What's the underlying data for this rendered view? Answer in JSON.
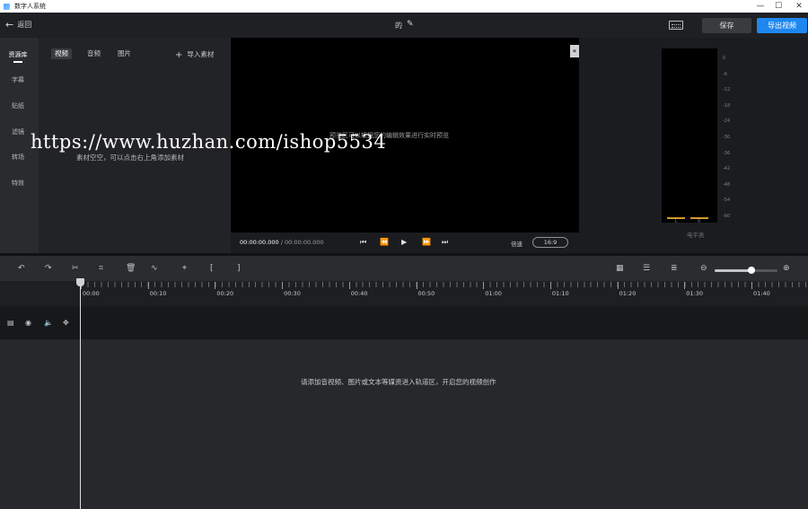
{
  "window": {
    "title": "数字人系统",
    "controls": [
      "—",
      "☐",
      "✕"
    ]
  },
  "topbar": {
    "back_label": "返回",
    "project_name": "的",
    "save_label": "保存",
    "export_label": "导出视频"
  },
  "sidebar": {
    "items": [
      {
        "label": "资源库",
        "active": true
      },
      {
        "label": "字幕"
      },
      {
        "label": "贴纸"
      },
      {
        "label": "滤镜"
      },
      {
        "label": "转场"
      },
      {
        "label": "特效"
      }
    ]
  },
  "assets": {
    "tabs": [
      {
        "label": "视频",
        "active": true
      },
      {
        "label": "音频"
      },
      {
        "label": "图片"
      }
    ],
    "import_label": "导入素材",
    "empty_message": "素材空空，可以点击右上角添加素材"
  },
  "preview": {
    "hint": "预览区可以根据您的编辑效果进行实时预览",
    "current_time": "00:00:00.000",
    "separator": " / ",
    "total_time": "00:00:00.000",
    "speed_label": "倍速",
    "ratio_label": "16:9"
  },
  "meter": {
    "ticks": [
      "0",
      "-6",
      "-12",
      "-18",
      "-24",
      "-30",
      "-36",
      "-42",
      "-48",
      "-54",
      "-60"
    ],
    "left_channel": "L",
    "right_channel": "R",
    "label": "电平表",
    "colors": {
      "level": "#d19a2a"
    }
  },
  "toolbar": {
    "zoom_level": 0.58
  },
  "ruler": {
    "labels": [
      "00:00",
      "00:10",
      "00:20",
      "00:30",
      "00:40",
      "00:50",
      "01:00",
      "01:10",
      "01:20",
      "01:30",
      "01:40"
    ]
  },
  "timeline": {
    "empty_message": "请添加音视频、图片或文本等媒资进入轨道区，开启您的视频创作"
  },
  "watermark": "https://www.huzhan.com/ishop5534",
  "colors": {
    "accent": "#1e87f0",
    "background": "#1b1c1f"
  }
}
